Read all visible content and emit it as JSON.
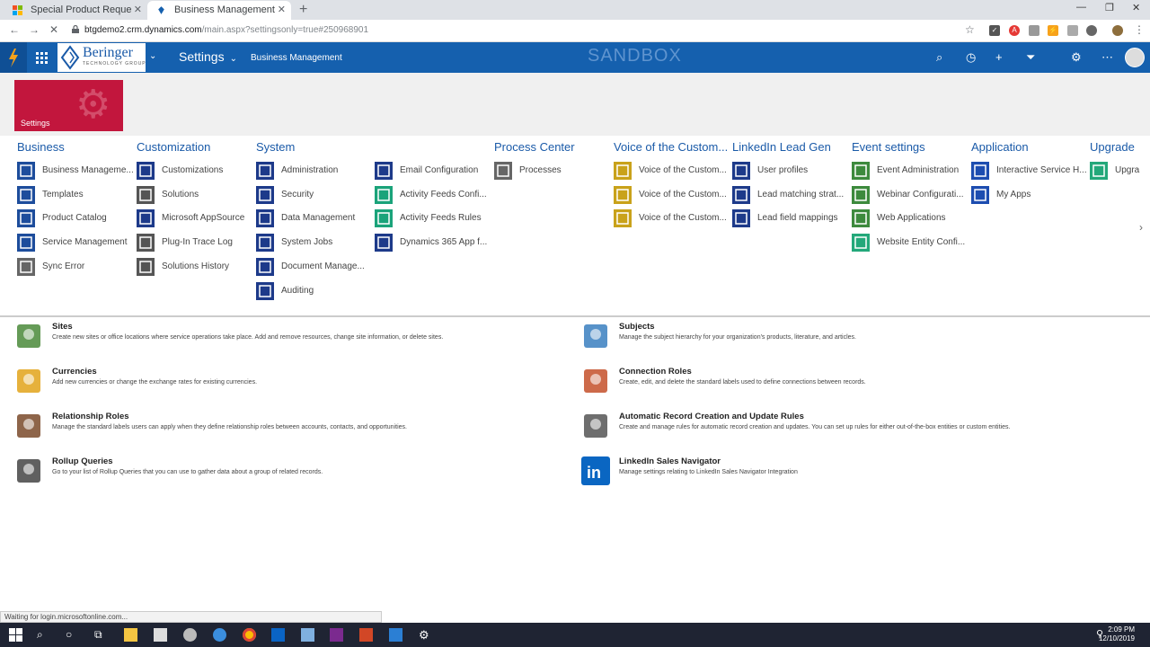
{
  "browser": {
    "tabs": [
      {
        "title": "Special Product Request: Informa",
        "active": false
      },
      {
        "title": "Business Management - Microso",
        "active": true
      }
    ],
    "url_host": "btgdemo2.crm.dynamics.com",
    "url_path": "/main.aspx?settingsonly=true#250968901",
    "status_text": "Waiting for login.microsoftonline.com..."
  },
  "navbar": {
    "logo_text": "Beringer",
    "logo_sub": "TECHNOLOGY GROUP",
    "area": "Settings",
    "breadcrumb": "Business Management",
    "environment": "SANDBOX"
  },
  "settings_tile_label": "Settings",
  "columns": [
    {
      "heading": "Business",
      "items": [
        "Business Manageme...",
        "Templates",
        "Product Catalog",
        "Service Management",
        "Sync Error"
      ]
    },
    {
      "heading": "Customization",
      "items": [
        "Customizations",
        "Solutions",
        "Microsoft AppSource",
        "Plug-In Trace Log",
        "Solutions History"
      ]
    },
    {
      "heading": "System",
      "items": [
        "Administration",
        "Security",
        "Data Management",
        "System Jobs",
        "Document Manage...",
        "Auditing"
      ]
    },
    {
      "heading": "",
      "items": [
        "Email Configuration",
        "Activity Feeds Confi...",
        "Activity Feeds Rules",
        "Dynamics 365 App f..."
      ]
    },
    {
      "heading": "Process Center",
      "items": [
        "Processes"
      ]
    },
    {
      "heading": "Voice of the Custom...",
      "items": [
        "Voice of the Custom...",
        "Voice of the Custom...",
        "Voice of the Custom..."
      ]
    },
    {
      "heading": "LinkedIn Lead Gen",
      "items": [
        "User profiles",
        "Lead matching strat...",
        "Lead field mappings"
      ]
    },
    {
      "heading": "Event settings",
      "items": [
        "Event Administration",
        "Webinar Configurati...",
        "Web Applications",
        "Website Entity Confi..."
      ]
    },
    {
      "heading": "Application",
      "items": [
        "Interactive Service H...",
        "My Apps"
      ]
    },
    {
      "heading": "Upgrade",
      "items": [
        "Upgra"
      ]
    }
  ],
  "entries": [
    {
      "title": "Sites",
      "desc": "Create new sites or office locations where service operations take place. Add and remove resources, change site information, or delete sites."
    },
    {
      "title": "Subjects",
      "desc": "Manage the subject hierarchy for your organization's products, literature, and articles."
    },
    {
      "title": "Currencies",
      "desc": "Add new currencies or change the exchange rates for existing currencies."
    },
    {
      "title": "Connection Roles",
      "desc": "Create, edit, and delete the standard labels used to define connections between records."
    },
    {
      "title": "Relationship Roles",
      "desc": "Manage the standard labels users can apply when they define relationship roles between accounts, contacts, and opportunities."
    },
    {
      "title": "Automatic Record Creation and Update Rules",
      "desc": "Create and manage rules for automatic record creation and updates. You can set up rules for either out-of-the-box entities or custom entities."
    },
    {
      "title": "Rollup Queries",
      "desc": "Go to your list of Rollup Queries that you can use to gather data about a group of related records."
    },
    {
      "title": "LinkedIn Sales Navigator",
      "desc": "Manage settings relating to LinkedIn Sales Navigator Integration"
    }
  ],
  "clock": {
    "time": "2:09 PM",
    "date": "12/10/2019"
  },
  "colors": {
    "nav": "#1560ae",
    "tile": "#c2163d",
    "heading": "#1a5aa8"
  }
}
